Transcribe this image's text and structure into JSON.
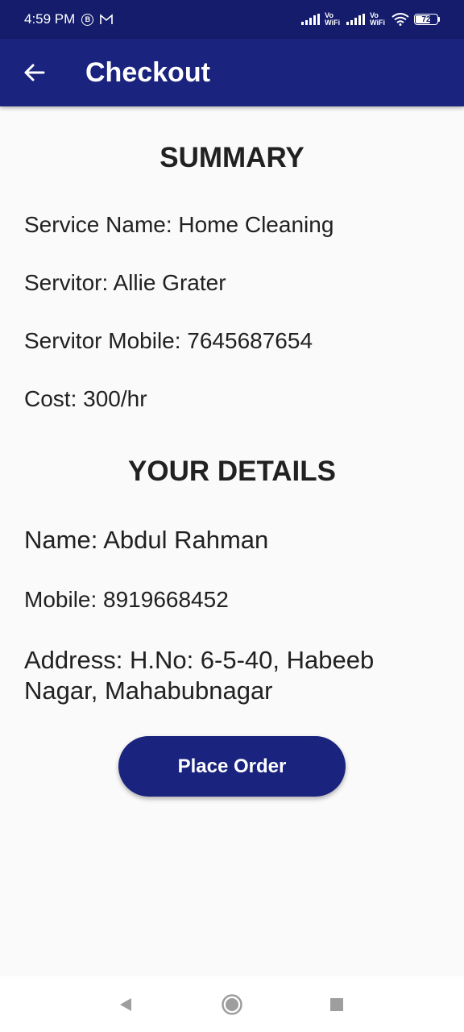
{
  "status_bar": {
    "time": "4:59 PM",
    "notif_b": "B",
    "notif_m": "M",
    "vowifi_top": "Vo",
    "vowifi_bottom": "WiFi",
    "battery": "72",
    "battery_level": 0.72
  },
  "app_bar": {
    "title": "Checkout"
  },
  "summary": {
    "heading": "SUMMARY",
    "service_name": "Service Name: Home Cleaning",
    "servitor": "Servitor: Allie Grater",
    "servitor_mobile": "Servitor Mobile: 7645687654",
    "cost": "Cost: 300/hr"
  },
  "details": {
    "heading": "YOUR DETAILS",
    "name": "Name: Abdul Rahman",
    "mobile": "Mobile: 8919668452",
    "address": "Address: H.No: 6-5-40, Habeeb Nagar, Mahabubnagar"
  },
  "actions": {
    "place_order": "Place Order"
  },
  "colors": {
    "primary": "#1a237e",
    "status_bar": "#141c6b",
    "background": "#fafafa"
  },
  "icons": {
    "back": "arrow-left-icon",
    "nav_back": "triangle-back-icon",
    "nav_home": "circle-home-icon",
    "nav_recents": "square-recents-icon"
  }
}
